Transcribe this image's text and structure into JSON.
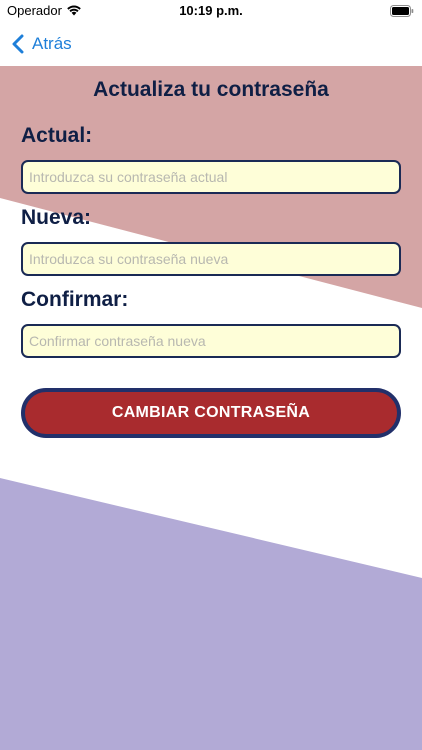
{
  "status_bar": {
    "carrier": "Operador",
    "time": "10:19 p.m."
  },
  "nav": {
    "back_label": "Atrás"
  },
  "form": {
    "title": "Actualiza tu contraseña",
    "fields": [
      {
        "label": "Actual:",
        "placeholder": "Introduzca su contraseña actual"
      },
      {
        "label": "Nueva:",
        "placeholder": "Introduzca su contraseña nueva"
      },
      {
        "label": "Confirmar:",
        "placeholder": "Confirmar contraseña nueva"
      }
    ],
    "submit_label": "CAMBIAR CONTRASEÑA"
  },
  "colors": {
    "accent_blue": "#1e7fd9",
    "top_shape": "#d4a5a5",
    "bottom_shape": "#b2aad6",
    "button": "#a92b2e",
    "button_border": "#22306a",
    "input_bg": "#fefed8",
    "heading": "#0f1f45"
  }
}
